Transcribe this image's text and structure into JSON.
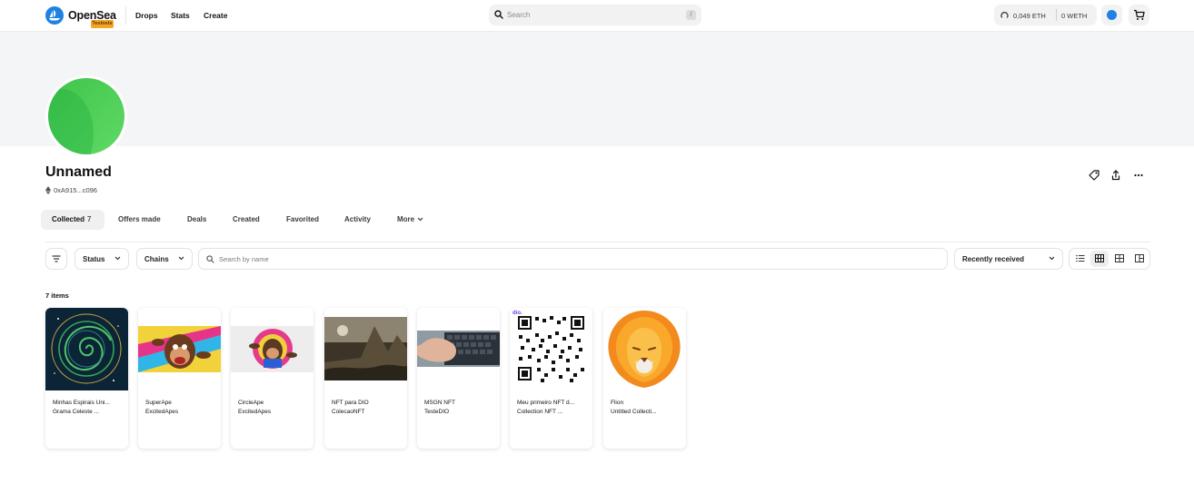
{
  "nav": {
    "brand": "OpenSea",
    "badge": "Testnets",
    "links": [
      "Drops",
      "Stats",
      "Create"
    ],
    "search_placeholder": "Search",
    "search_shortcut": "/",
    "eth_balance": "0,049 ETH",
    "weth_balance": "0 WETH",
    "avatar_color": "#2081e2"
  },
  "profile": {
    "name": "Unnamed",
    "address": "0xA915...c096",
    "avatar_colors": [
      "#3fc54a",
      "#5fd966"
    ]
  },
  "tabs": [
    {
      "label": "Collected",
      "count": "7"
    },
    {
      "label": "Offers made"
    },
    {
      "label": "Deals"
    },
    {
      "label": "Created"
    },
    {
      "label": "Favorited"
    },
    {
      "label": "Activity"
    },
    {
      "label": "More"
    }
  ],
  "filters": {
    "status": "Status",
    "chains": "Chains",
    "search_placeholder": "Search by name",
    "sort": "Recently received"
  },
  "items_count": "7 items",
  "items": [
    {
      "name": "Minhas Espirais Uni...",
      "collection": "Grama Celeste ..."
    },
    {
      "name": "SuperApe",
      "collection": "ExcitedApes"
    },
    {
      "name": "CircleApe",
      "collection": "ExcitedApes"
    },
    {
      "name": "NFT para DIO",
      "collection": "ColecaoNFT"
    },
    {
      "name": "MSGN NFT",
      "collection": "TesteDIO"
    },
    {
      "name": "Meu primeiro NFT d...",
      "collection": "Collection NFT ..."
    },
    {
      "name": "Flion",
      "collection": "Untitled Collecti..."
    }
  ]
}
